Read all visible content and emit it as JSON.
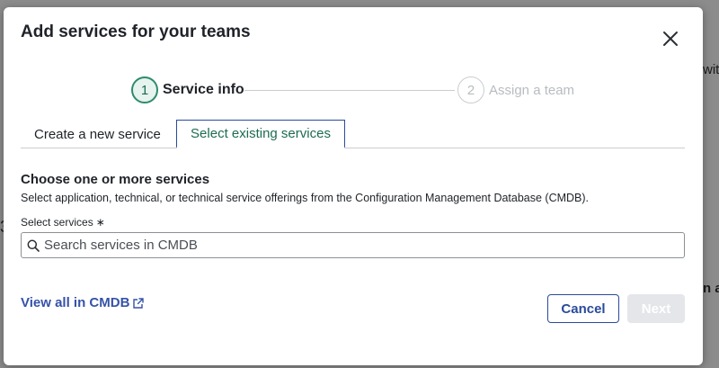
{
  "background": {
    "fragment_right_top": "with",
    "fragment_right_bottom": "n al",
    "fragment_left": "3"
  },
  "modal": {
    "title": "Add services for your teams",
    "close_icon": "close-icon"
  },
  "stepper": {
    "steps": [
      {
        "number": "1",
        "label": "Service info",
        "state": "active"
      },
      {
        "number": "2",
        "label": "Assign a team",
        "state": "inactive"
      }
    ]
  },
  "tabs": [
    {
      "label": "Create a new service",
      "selected": false
    },
    {
      "label": "Select existing services",
      "selected": true
    }
  ],
  "section": {
    "title": "Choose one or more services",
    "description": "Select application, technical, or technical service offerings from the Configuration Management Database (CMDB)."
  },
  "field": {
    "label": "Select services",
    "required_mark": "∗",
    "placeholder": "Search services in CMDB",
    "value": ""
  },
  "footer": {
    "link_label": "View all in CMDB",
    "cancel_label": "Cancel",
    "next_label": "Next"
  },
  "colors": {
    "accent_green": "#2e8b6e",
    "link_blue": "#3552a8",
    "button_blue": "#2a4a9a",
    "disabled_gray": "#e4e6ea"
  }
}
